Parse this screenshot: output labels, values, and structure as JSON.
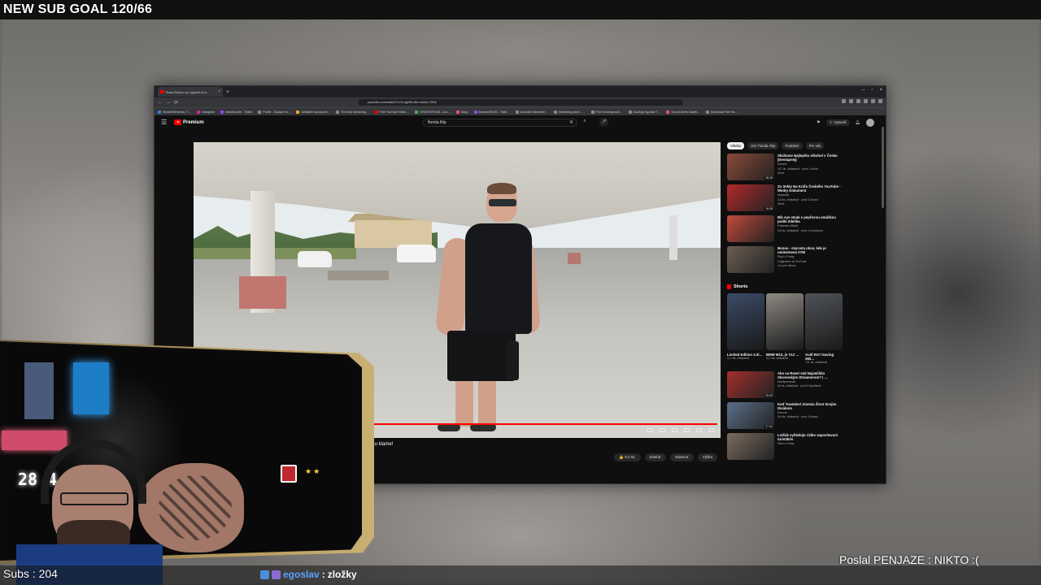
{
  "overlay": {
    "sub_goal": "NEW SUB GOAL 120/66",
    "subs_label": "Subs : 204",
    "donation_text": "Poslal PENJAZE : NIKTO :(",
    "chat": {
      "user": "egoslav",
      "separator": ":",
      "message": "zložky"
    },
    "lcd_readout": "28 4"
  },
  "browser": {
    "tab": {
      "title": "Bosa Boblon se vyjadril ze k…",
      "close": "×"
    },
    "new_tab": "+",
    "window_controls": {
      "minimize": "–",
      "maximize": "▫",
      "close": "×"
    },
    "nav": {
      "back": "←",
      "forward": "→",
      "reload": "⟳"
    },
    "url": "youtube.com/watch?v=0-sgliIAL&ts=tsk&t=750s",
    "bookmarks": [
      {
        "label": "StreamElements | T…",
        "color": "#3a7bd5"
      },
      {
        "label": "Instagram",
        "color": "#d6249f"
      },
      {
        "label": "leitoderonde - Twitch",
        "color": "#9146ff"
      },
      {
        "label": "Profile - Escape fro…",
        "color": "#888888"
      },
      {
        "label": "Available sponsorsh…",
        "color": "#f5a623"
      },
      {
        "label": "The best streaming…",
        "color": "#888888"
      },
      {
        "label": "Free YouTube Video…",
        "color": "#ff0000"
      },
      {
        "label": "CREATOR/HUB - Acc…",
        "color": "#4caf50"
      },
      {
        "label": "Bánp",
        "color": "#e94e77"
      },
      {
        "label": "BrowserEDGE - Twitc…",
        "color": "#9146ff"
      },
      {
        "label": "Animate Subscribe…",
        "color": "#888888"
      },
      {
        "label": "Streaming panel - …",
        "color": "#888888"
      },
      {
        "label": "Free Underground…",
        "color": "#888888"
      },
      {
        "label": "AlcoEgo Egoslav T…",
        "color": "#888888"
      },
      {
        "label": "Sound Alerts Dashb…",
        "color": "#e94e77"
      },
      {
        "label": "Download Free Bo…",
        "color": "#888888"
      }
    ]
  },
  "youtube": {
    "logo": "Premium",
    "search_query": "florida filip",
    "create_label": "Vytvoriť",
    "video": {
      "title": "ekto tu klame!",
      "progress_fraction": 0.99
    },
    "actions": [
      "👍 9,2 tis.",
      "Zdieľať",
      "Stiahnuť",
      "Výška"
    ],
    "chips": [
      "Všetko",
      "Od: Florida Filip",
      "Podobné",
      "Pre vás"
    ],
    "chips_active_index": 0,
    "recommendations": [
      {
        "title": "Skúšame Najlepšiu Alkohol v Česku (Destupnej)",
        "channel": "Zuback",
        "stats": "147 tis. zhliadnutí · pred 1 dňom",
        "badge": "Nové",
        "duration": "26:28",
        "color": "#8a4a3a"
      },
      {
        "title": "Zo Sekty Na Kráľa Českého YouTube - Wedry Dokument",
        "channel": "Magnolik",
        "stats": "3,6 tis. zhliadnutí · pred 3 dňami",
        "badge": "Nové",
        "duration": "19:28",
        "color": "#b22a2a"
      },
      {
        "title": "Bib eye steak s pepřovou omáčkou podle Zdeňka",
        "channel": "Pobierán official",
        "stats": "3,6 tis. zhliadnutí · pred 1 mesiacom",
        "badge": "",
        "duration": "",
        "color": "#c24a3c"
      },
      {
        "title": "Bonus - starosta obce, kde je umiestnená ATM",
        "channel": "Plácl z Prahy",
        "stats": "Originálne na YouTube",
        "badge": "Len pre členov",
        "duration": "",
        "color": "#6c5e52"
      }
    ],
    "shorts_heading": "Shorts",
    "shorts": [
      {
        "title": "Limited Edition 4.3l…",
        "views": "1,1 mil. zhliadnutí",
        "color": "#3b4b66"
      },
      {
        "title": "BMW M12, je V12 …",
        "views": "3,2 mil. zhliadnutí",
        "color": "#8e8a84"
      },
      {
        "title": "Audi RS7 leaving 280…",
        "views": "721 tis. zhliadnutí",
        "color": "#4f5358"
      }
    ],
    "recommendations_more": [
      {
        "title": "Ako sa Reset stal Najväčším Slovenským Streamerom? | …",
        "channel": "resetprovenan",
        "stats": "54 tis. zhliadnutí · pred 3 týždňami",
        "duration": "25:43",
        "color": "#a2302c"
      },
      {
        "title": "Keď Youtuberi Zmenia Život Svojim Divákom",
        "channel": "Dzoove",
        "stats": "8,6 tis. zhliadnutí · pred 3 dňami",
        "duration": "27:44",
        "color": "#5c6f8a"
      },
      {
        "title": "Lotšák vyhlašuje riziko zapocítavani turistikím",
        "channel": "Plácl z Prahy",
        "stats": "",
        "duration": "",
        "color": "#7b6c60"
      }
    ]
  }
}
